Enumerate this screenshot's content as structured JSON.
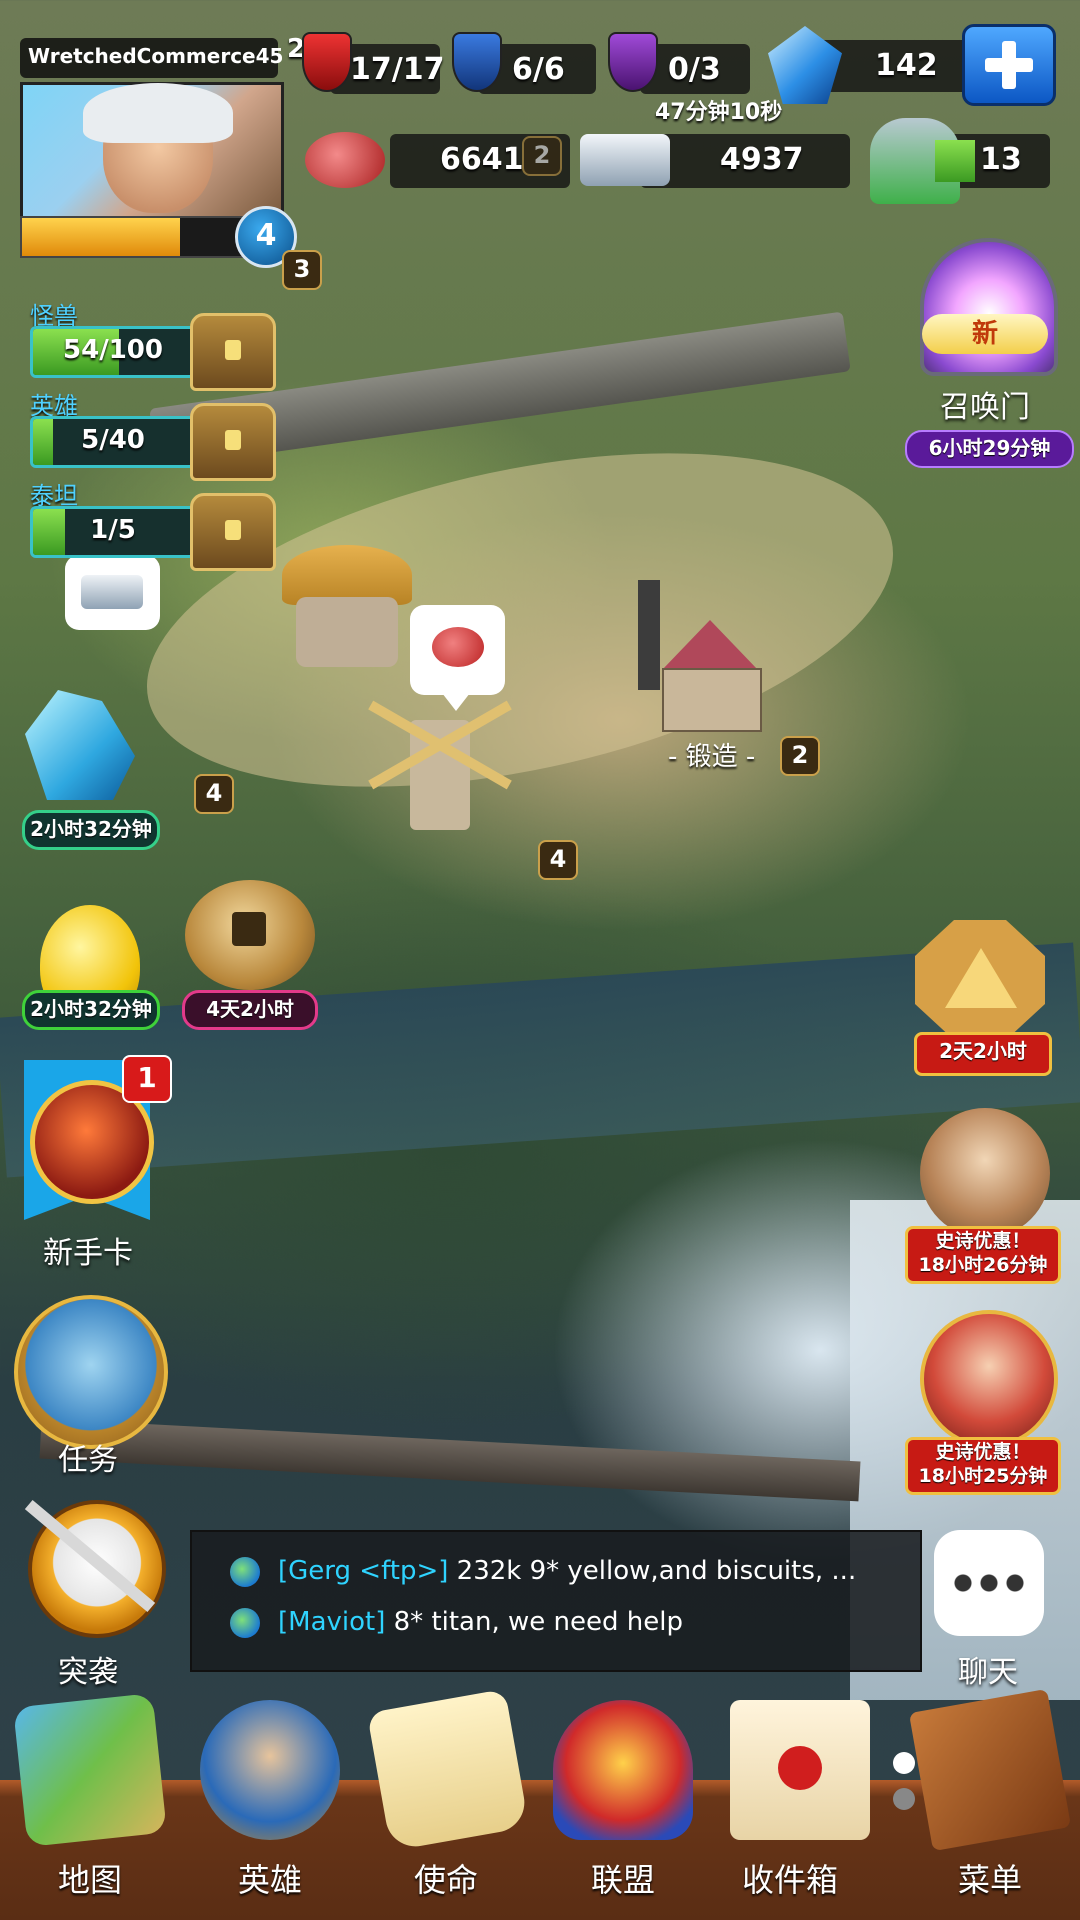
{
  "player": {
    "name": "WretchedCommerce45",
    "level": "4",
    "xp_fraction": 0.72,
    "profile_level_badge": "3",
    "side_badge": "2"
  },
  "resources": {
    "raids": "17/17",
    "swords": "6/6",
    "skull": "0/3",
    "skull_timer": "47分钟10秒",
    "gems": "142",
    "food": "6641",
    "iron": "4937",
    "troops": "13",
    "food_building_level": "2"
  },
  "progress": [
    {
      "label": "怪兽",
      "value": "54/100",
      "fraction": 0.54
    },
    {
      "label": "英雄",
      "value": "5/40",
      "fraction": 0.125
    },
    {
      "label": "泰坦",
      "value": "1/5",
      "fraction": 0.2
    }
  ],
  "buildings": {
    "forge_label": "锻造",
    "forge_level": "2",
    "crystal_level": "4",
    "crystal_timer": "2小时32分钟",
    "windmill_level": "4"
  },
  "portal": {
    "badge": "新",
    "label": "召唤门",
    "timer": "6小时29分钟"
  },
  "events": {
    "egg_timer": "2小时32分钟",
    "coins_timer": "4天2小时",
    "pyramid_timer": "2天2小时"
  },
  "left_menu": {
    "starter_card": "新手卡",
    "starter_badge": "1",
    "quests": "任务",
    "raid": "突袭"
  },
  "offers": [
    {
      "title": "史诗优惠！",
      "timer": "18小时26分钟"
    },
    {
      "title": "史诗优惠！",
      "timer": "18小时25分钟"
    }
  ],
  "chat": {
    "label": "聊天",
    "messages": [
      {
        "user": "[Gerg <ftp>]",
        "text": " 232k 9* yellow,and biscuits, ..."
      },
      {
        "user": "[Maviot]",
        "text": " 8* titan, we need help"
      }
    ]
  },
  "nav": [
    "地图",
    "英雄",
    "使命",
    "联盟",
    "收件箱",
    "菜单"
  ],
  "colors": {
    "accent_cyan": "#39c2c8",
    "offer_red": "#c71a14",
    "portal_purple": "#5a1a9a",
    "nav_brown": "#6a3618",
    "chat_user": "#2fd3ff"
  }
}
